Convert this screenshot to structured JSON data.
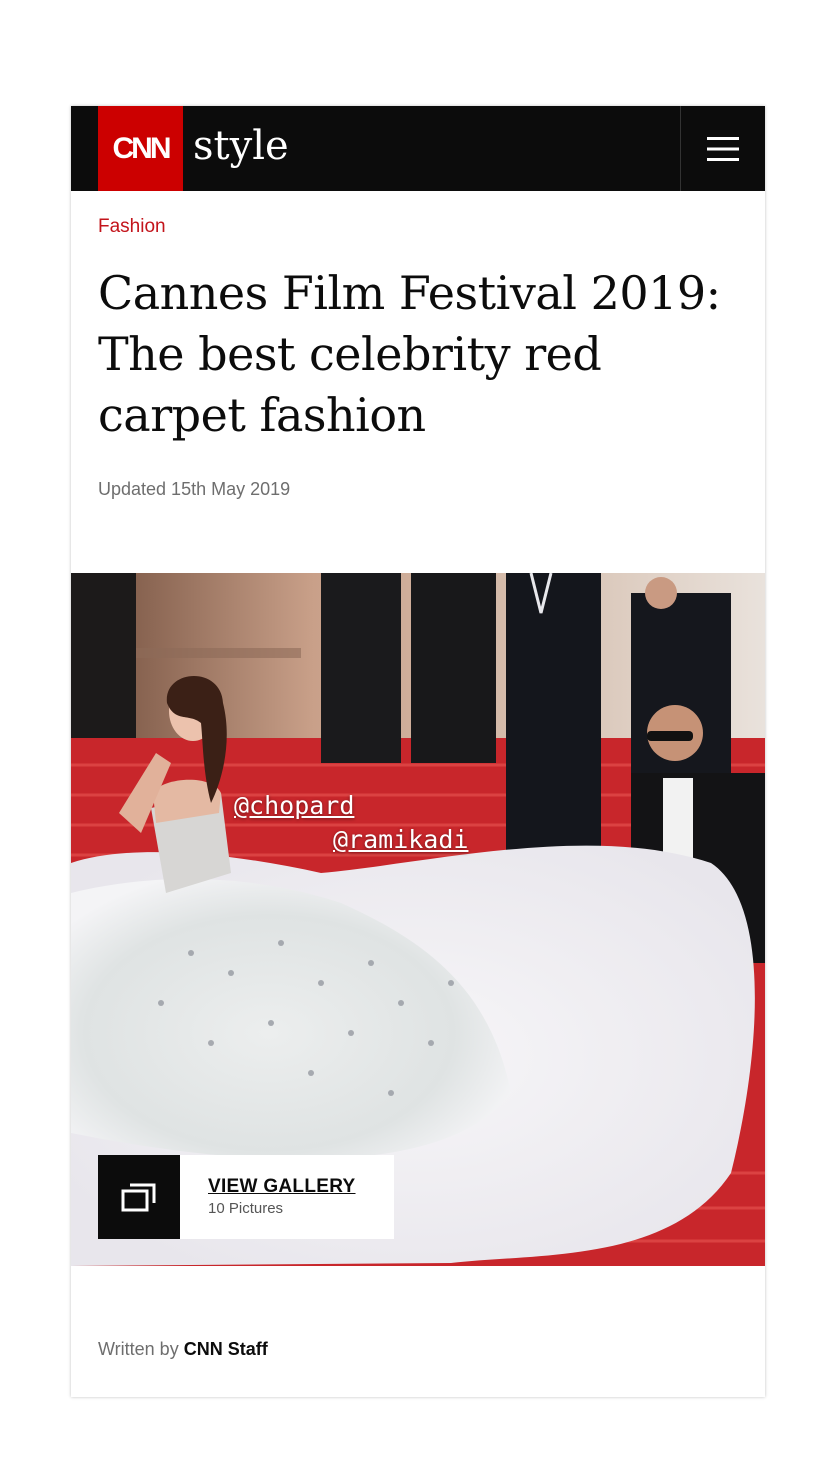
{
  "header": {
    "logo_text": "CNN",
    "brand": "style",
    "menu_icon": "hamburger-menu-icon",
    "colors": {
      "logo_red": "#cc0000",
      "bar": "#0c0c0c"
    }
  },
  "article": {
    "section": "Fashion",
    "headline": "Cannes Film Festival 2019: The best celebrity red carpet fashion",
    "updated": "Updated 15th May 2019"
  },
  "hero": {
    "tags": [
      "@chopard",
      "@ramikadi"
    ],
    "gallery": {
      "icon": "gallery-stack-icon",
      "label": "VIEW GALLERY",
      "count": "10 Pictures"
    }
  },
  "byline": {
    "prefix": "Written by",
    "author": "CNN Staff"
  }
}
